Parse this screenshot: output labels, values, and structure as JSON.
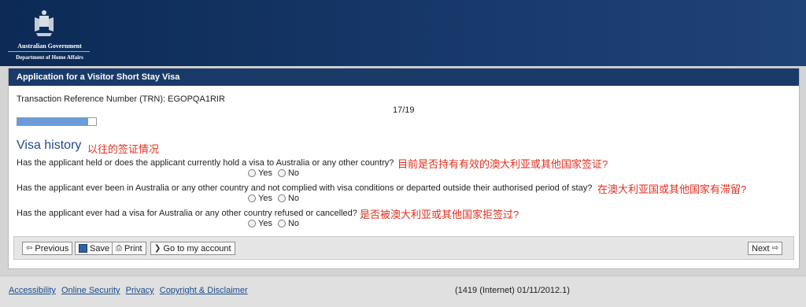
{
  "header": {
    "logo_line1": "Australian Government",
    "logo_line2": "Department of Home Affairs"
  },
  "panel": {
    "title": "Application for a Visitor Short Stay Visa",
    "trn": "Transaction Reference Number (TRN): EGOPQA1RIR",
    "progress_text": "17/19",
    "progress_fraction": 0.895
  },
  "section": {
    "title": "Visa history",
    "annotation": "以往的签证情况"
  },
  "questions": [
    {
      "text": "Has the applicant held or does the applicant currently hold a visa to Australia or any other country?",
      "annotation": "目前是否持有有效的澳大利亚或其他国家签证?",
      "yes": "Yes",
      "no": "No"
    },
    {
      "text": "Has the applicant ever been in Australia or any other country and not complied with visa conditions or departed outside their authorised period of stay?",
      "annotation": "在澳大利亚国或其他国家有滞留?",
      "yes": "Yes",
      "no": "No"
    },
    {
      "text": "Has the applicant ever had a visa for Australia or any other country refused or cancelled?",
      "annotation": "是否被澳大利亚或其他国家拒签过?",
      "yes": "Yes",
      "no": "No"
    }
  ],
  "buttons": {
    "previous": "Previous",
    "save": "Save",
    "print": "Print",
    "account": "Go to my account",
    "next": "Next"
  },
  "footer": {
    "links": [
      "Accessibility",
      "Online Security",
      "Privacy",
      "Copyright & Disclaimer"
    ],
    "version": "(1419 (Internet) 01/11/2012.1)"
  },
  "colors": {
    "header_bg": "#17386a",
    "annotation_red": "#e03020",
    "section_blue": "#1f4a8c",
    "progress_fill": "#6b9bd8"
  }
}
